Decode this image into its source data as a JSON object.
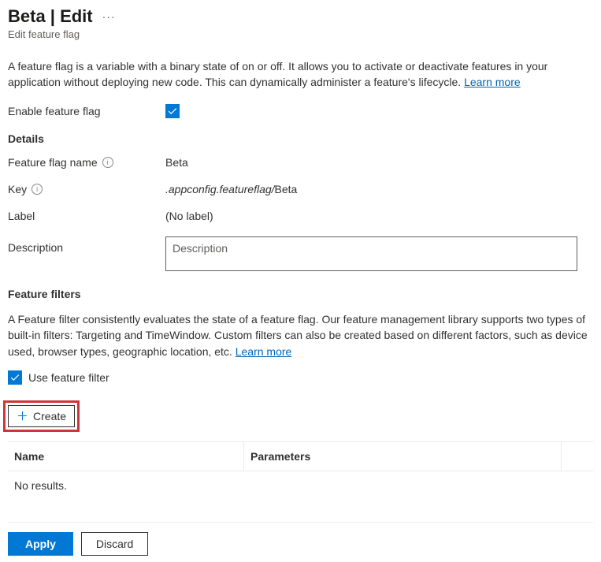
{
  "header": {
    "title": "Beta | Edit",
    "subtitle": "Edit feature flag"
  },
  "intro": {
    "text": "A feature flag is a variable with a binary state of on or off. It allows you to activate or deactivate features in your application without deploying new code. This can dynamically administer a feature's lifecycle. ",
    "learn_more": "Learn more"
  },
  "form": {
    "enable_label": "Enable feature flag",
    "enable_checked": true
  },
  "details": {
    "section_title": "Details",
    "name_label": "Feature flag name",
    "name_value": "Beta",
    "key_label": "Key",
    "key_prefix": ".appconfig.featureflag/",
    "key_value": "Beta",
    "label_label": "Label",
    "label_value": "(No label)",
    "description_label": "Description",
    "description_placeholder": "Description",
    "description_value": ""
  },
  "filters": {
    "section_title": "Feature filters",
    "intro_text": "A Feature filter consistently evaluates the state of a feature flag. Our feature management library supports two types of built-in filters: Targeting and TimeWindow. Custom filters can also be created based on different factors, such as device used, browser types, geographic location, etc. ",
    "learn_more": "Learn more",
    "use_filter_label": "Use feature filter",
    "use_filter_checked": true,
    "create_label": "Create",
    "table": {
      "col_name": "Name",
      "col_params": "Parameters",
      "empty": "No results."
    }
  },
  "footer": {
    "apply": "Apply",
    "discard": "Discard"
  }
}
